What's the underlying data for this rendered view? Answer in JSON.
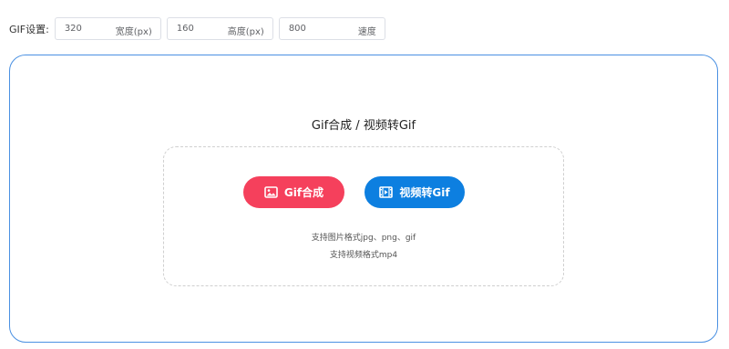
{
  "settings": {
    "label": "GIF设置:",
    "width": {
      "value": "320",
      "unit": "宽度(px)"
    },
    "height": {
      "value": "160",
      "unit": "高度(px)"
    },
    "speed": {
      "value": "800",
      "unit": "速度"
    }
  },
  "main": {
    "title": "Gif合成 / 视频转Gif",
    "buttons": {
      "gif_compose": {
        "label": "Gif合成",
        "icon": "image-icon",
        "color": "#f5405c"
      },
      "video_to_gif": {
        "label": "视频转Gif",
        "icon": "film-icon",
        "color": "#0d7fe0"
      }
    },
    "hints": {
      "image_formats": "支持图片格式jpg、png、gif",
      "video_formats": "支持视频格式mp4"
    }
  },
  "colors": {
    "panel_border": "#4a90e2",
    "dashed_border": "#cfcfcf"
  }
}
